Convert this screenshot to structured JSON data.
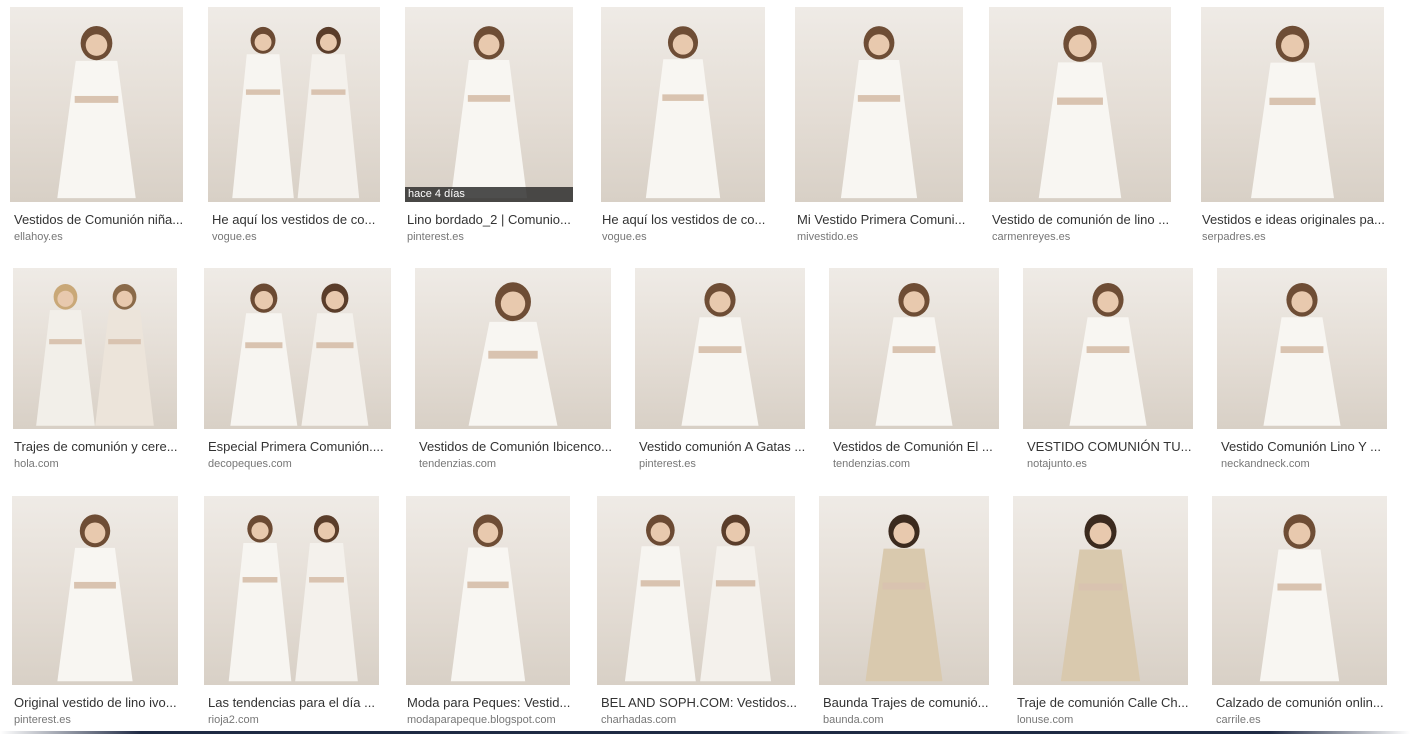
{
  "results": [
    {
      "title": "Vestidos de Comunión niña...",
      "source": "ellahoy.es",
      "image": "girl-white-dress-photo"
    },
    {
      "title": "He aquí los vestidos de co...",
      "source": "vogue.es",
      "image": "two-girls-white-dresses-photo"
    },
    {
      "title": "Lino bordado_2 | Comunio...",
      "source": "pinterest.es",
      "image": "girl-white-dress-photo",
      "badge": "hace 4 días"
    },
    {
      "title": "He aquí los vestidos de co...",
      "source": "vogue.es",
      "image": "girl-white-dress-photo"
    },
    {
      "title": "Mi Vestido Primera Comuni...",
      "source": "mivestido.es",
      "image": "girl-white-dress-photo"
    },
    {
      "title": "Vestido de comunión de lino ...",
      "source": "carmenreyes.es",
      "image": "girl-white-dress-photo"
    },
    {
      "title": "Vestidos e ideas originales pa...",
      "source": "serpadres.es",
      "image": "girl-white-dress-photo"
    },
    {
      "title": "Trajes de comunión y cere...",
      "source": "hola.com",
      "image": "boy-and-girl-photo"
    },
    {
      "title": "Especial Primera Comunión....",
      "source": "decopeques.com",
      "image": "two-girls-white-dresses-photo"
    },
    {
      "title": "Vestidos de Comunión Ibicenco...",
      "source": "tendenzias.com",
      "image": "girl-white-dress-photo"
    },
    {
      "title": "Vestido comunión A Gatas ...",
      "source": "pinterest.es",
      "image": "girl-white-dress-photo"
    },
    {
      "title": "Vestidos de Comunión El ...",
      "source": "tendenzias.com",
      "image": "girl-white-dress-photo"
    },
    {
      "title": "VESTIDO COMUNIÓN TU...",
      "source": "notajunto.es",
      "image": "girl-white-dress-photo"
    },
    {
      "title": "Vestido Comunión Lino Y ...",
      "source": "neckandneck.com",
      "image": "girl-white-dress-back-photo"
    },
    {
      "title": "Original vestido de lino ivo...",
      "source": "pinterest.es",
      "image": "girl-white-dress-photo"
    },
    {
      "title": "Las tendencias para el día ...",
      "source": "rioja2.com",
      "image": "two-girls-white-dresses-photo"
    },
    {
      "title": "Moda para Peques: Vestid...",
      "source": "modaparapeque.blogspot.com",
      "image": "girl-white-dress-photo"
    },
    {
      "title": "BEL AND SOPH.COM: Vestidos...",
      "source": "charhadas.com",
      "image": "two-girls-white-dresses-photo"
    },
    {
      "title": "Baunda Trajes de comunió...",
      "source": "baunda.com",
      "image": "boy-beige-suit-photo"
    },
    {
      "title": "Traje de comunión Calle Ch...",
      "source": "lonuse.com",
      "image": "boy-beige-suit-photo"
    },
    {
      "title": "Calzado de comunión onlin...",
      "source": "carrile.es",
      "image": "girl-white-dress-photo"
    }
  ],
  "colors": {
    "title_text": "#333333",
    "source_text": "#777777",
    "badge_bg": "#2a2a2a"
  }
}
